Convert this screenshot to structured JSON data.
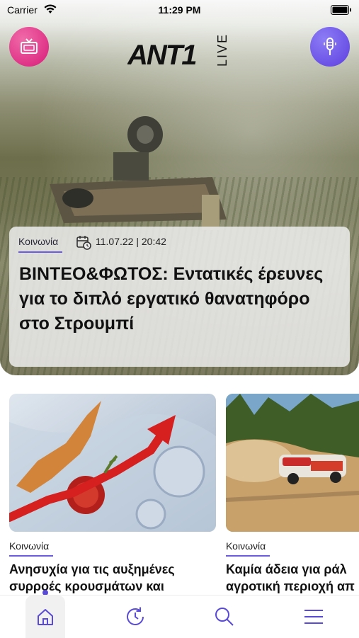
{
  "status_bar": {
    "carrier": "Carrier",
    "time": "11:29 PM"
  },
  "header": {
    "logo_text": "ANT1",
    "logo_sub": "LIVE",
    "tv_icon": "tv-icon",
    "mic_icon": "microphone-icon"
  },
  "hero": {
    "category": "Κοινωνία",
    "date": "11.07.22 | 20:42",
    "title": "ΒΙΝΤΕΟ&ΦΩΤΟΣ: Εντατικές έρευνες για το διπλό εργατικό θανατηφόρο στο Στρουμπί"
  },
  "tiles": [
    {
      "category": "Κοινωνία",
      "title_line1": "Ανησυχία για τις αυξημένες",
      "title_line2": "συρροές κρουσμάτων και"
    },
    {
      "category": "Κοινωνία",
      "title_line1": "Καμία άδεια για ράλ",
      "title_line2": "αγροτική περιοχή απ"
    }
  ],
  "tabbar": {
    "items": [
      "home-icon",
      "history-icon",
      "search-icon",
      "menu-icon"
    ]
  },
  "colors": {
    "accent": "#5d3fe0",
    "pink": "#d81b79",
    "underline": "#6b5be0"
  }
}
